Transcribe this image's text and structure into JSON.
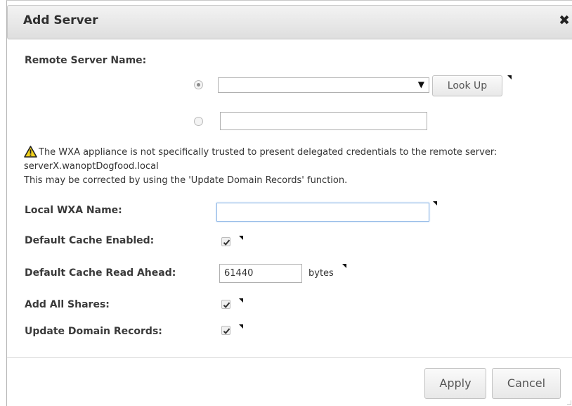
{
  "dialog": {
    "title": "Add Server",
    "close_icon": "close-icon"
  },
  "remote_server": {
    "label": "Remote Server Name:",
    "select_value": "",
    "lookup_label": "Look Up",
    "text_value": ""
  },
  "warning": {
    "icon": "warning-icon",
    "line1": "The WXA appliance is not specifically trusted to present delegated credentials to the remote server:",
    "line2": "serverX.wanoptDogfood.local",
    "line3": "This may be corrected by using the 'Update Domain Records' function."
  },
  "fields": {
    "local_wxa_label": "Local WXA Name:",
    "local_wxa_value": "",
    "cache_enabled_label": "Default Cache Enabled:",
    "cache_enabled_checked": true,
    "read_ahead_label": "Default Cache Read Ahead:",
    "read_ahead_value": "61440",
    "read_ahead_unit": "bytes",
    "add_shares_label": "Add All Shares:",
    "add_shares_checked": true,
    "update_records_label": "Update Domain Records:",
    "update_records_checked": true
  },
  "footer": {
    "apply_label": "Apply",
    "cancel_label": "Cancel"
  },
  "colors": {
    "warning_yellow": "#f2d21b",
    "focus_border": "#8fb7e6"
  }
}
